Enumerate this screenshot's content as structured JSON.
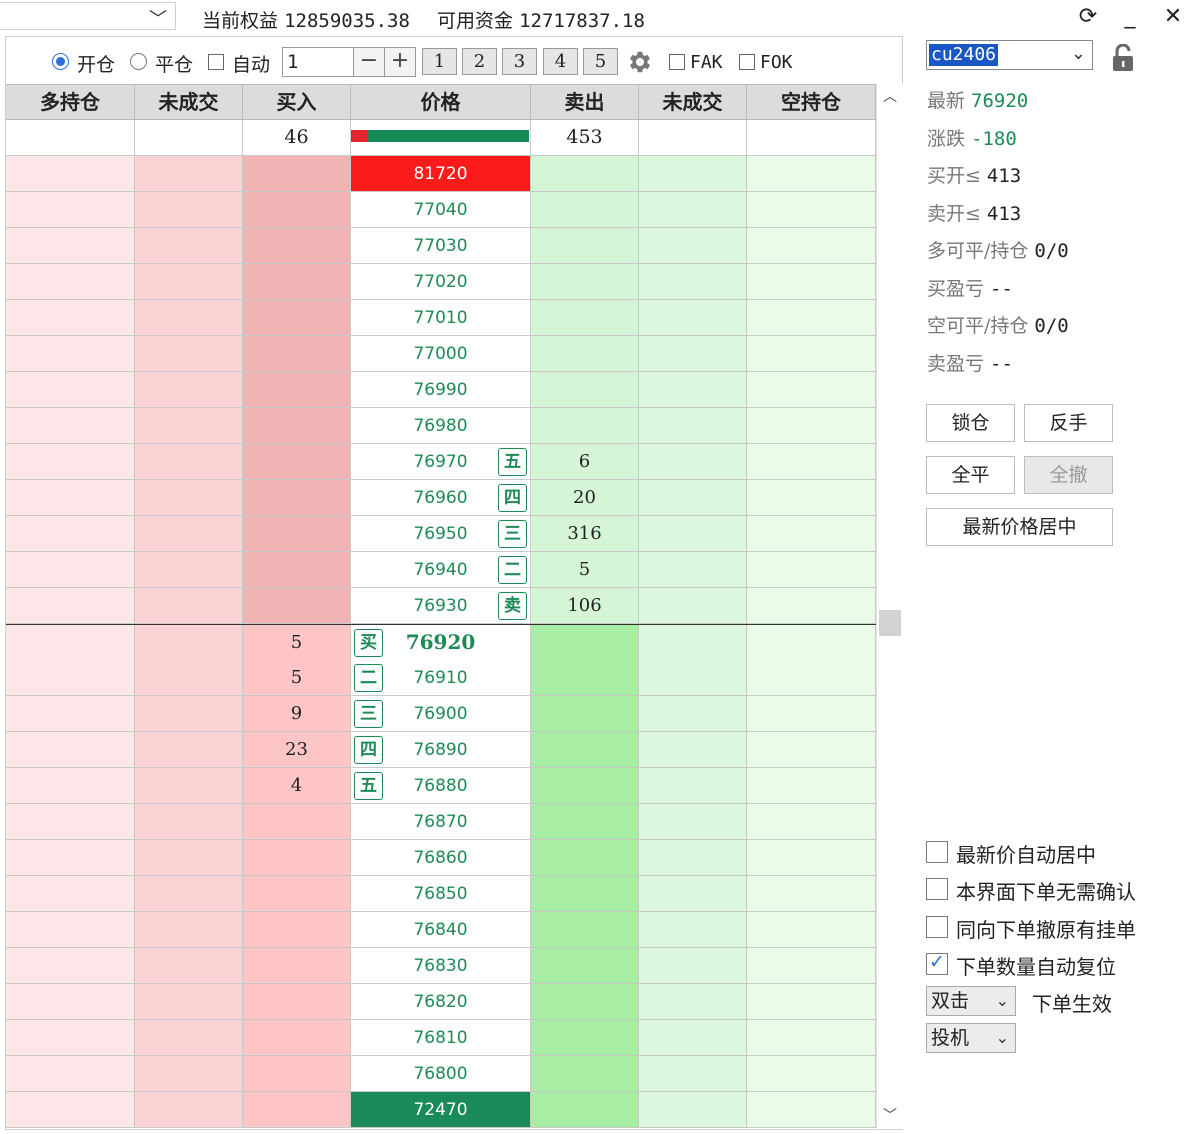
{
  "top": {
    "equity_label": "当前权益",
    "equity_value": "12859035.38",
    "available_label": "可用资金",
    "available_value": "12717837.18"
  },
  "toolbar": {
    "open_label": "开仓",
    "close_label": "平仓",
    "auto_label": "自动",
    "quantity": "1",
    "presets": [
      "1",
      "2",
      "3",
      "4",
      "5"
    ],
    "fak_label": "FAK",
    "fok_label": "FOK"
  },
  "headers": [
    "多持仓",
    "未成交",
    "买入",
    "价格",
    "卖出",
    "未成交",
    "空持仓"
  ],
  "summary": {
    "buy_total": "46",
    "sell_total": "453",
    "buy_ratio": 0.09
  },
  "limit_up": "81720",
  "limit_down": "72470",
  "ask_rows": [
    {
      "price": "77040",
      "qty": "",
      "level": ""
    },
    {
      "price": "77030",
      "qty": "",
      "level": ""
    },
    {
      "price": "77020",
      "qty": "",
      "level": ""
    },
    {
      "price": "77010",
      "qty": "",
      "level": ""
    },
    {
      "price": "77000",
      "qty": "",
      "level": ""
    },
    {
      "price": "76990",
      "qty": "",
      "level": ""
    },
    {
      "price": "76980",
      "qty": "",
      "level": ""
    },
    {
      "price": "76970",
      "qty": "6",
      "level": "五"
    },
    {
      "price": "76960",
      "qty": "20",
      "level": "四"
    },
    {
      "price": "76950",
      "qty": "316",
      "level": "三"
    },
    {
      "price": "76940",
      "qty": "5",
      "level": "二"
    },
    {
      "price": "76930",
      "qty": "106",
      "level": "卖"
    }
  ],
  "bid_rows": [
    {
      "price": "76920",
      "qty": "5",
      "level": "买",
      "last": true
    },
    {
      "price": "76910",
      "qty": "5",
      "level": "二"
    },
    {
      "price": "76900",
      "qty": "9",
      "level": "三"
    },
    {
      "price": "76890",
      "qty": "23",
      "level": "四"
    },
    {
      "price": "76880",
      "qty": "4",
      "level": "五"
    },
    {
      "price": "76870",
      "qty": "",
      "level": ""
    },
    {
      "price": "76860",
      "qty": "",
      "level": ""
    },
    {
      "price": "76850",
      "qty": "",
      "level": ""
    },
    {
      "price": "76840",
      "qty": "",
      "level": ""
    },
    {
      "price": "76830",
      "qty": "",
      "level": ""
    },
    {
      "price": "76820",
      "qty": "",
      "level": ""
    },
    {
      "price": "76810",
      "qty": "",
      "level": ""
    },
    {
      "price": "76800",
      "qty": "",
      "level": ""
    }
  ],
  "side": {
    "symbol": "cu2406",
    "latest_label": "最新",
    "latest_value": "76920",
    "change_label": "涨跌",
    "change_value": "-180",
    "buy_open_label": "买开≤",
    "buy_open_value": "413",
    "sell_open_label": "卖开≤",
    "sell_open_value": "413",
    "long_label": "多可平/持仓",
    "long_value": "0/0",
    "buy_pnl_label": "买盈亏",
    "buy_pnl_value": "--",
    "short_label": "空可平/持仓",
    "short_value": "0/0",
    "sell_pnl_label": "卖盈亏",
    "sell_pnl_value": "--",
    "lock_btn": "锁仓",
    "reverse_btn": "反手",
    "close_all_btn": "全平",
    "cancel_all_btn": "全撤",
    "center_btn": "最新价格居中",
    "opt_auto_center": "最新价自动居中",
    "opt_no_confirm": "本界面下单无需确认",
    "opt_cancel_same": "同向下单撤原有挂单",
    "opt_reset_qty": "下单数量自动复位",
    "click_mode": "双击",
    "click_mode_label": "下单生效",
    "hedge_mode": "投机"
  },
  "colors": {
    "price_green": "#1f8a55",
    "limit_up_bg": "#fb1b1b",
    "limit_down_bg": "#1a8a5a"
  }
}
